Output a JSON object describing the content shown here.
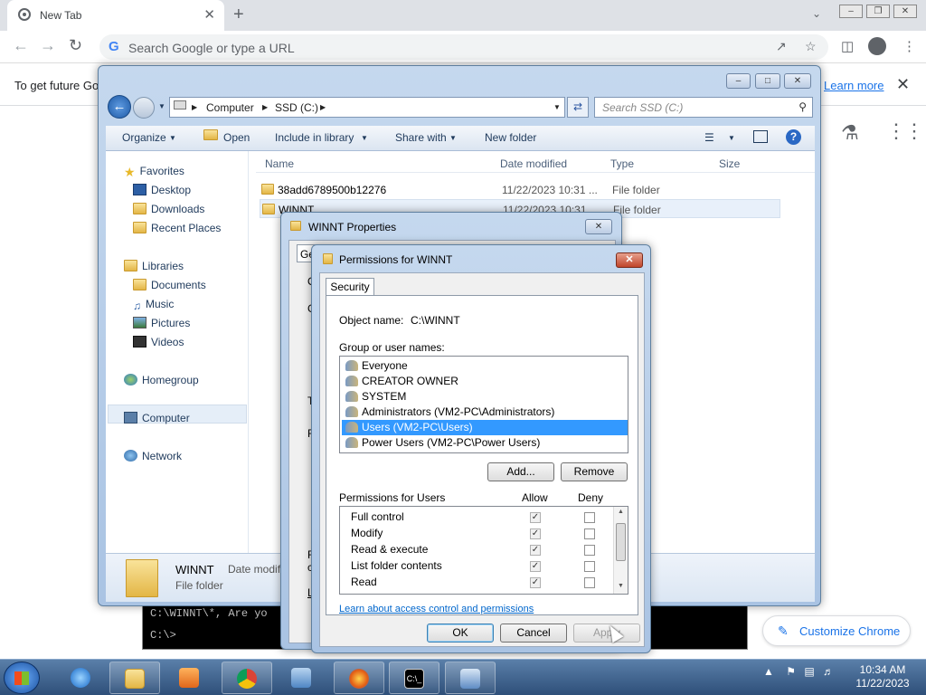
{
  "chrome": {
    "tab_title": "New Tab",
    "tab_close": "✕",
    "new_tab": "+",
    "omnibox_placeholder": "Search Google or type a URL",
    "infobar_message": "To get future Go",
    "infobar_learn_more": "Learn more",
    "customize_label": "Customize Chrome"
  },
  "explorer": {
    "breadcrumb": [
      "Computer",
      "SSD (C:)"
    ],
    "search_placeholder": "Search SSD (C:)",
    "commands": [
      "Organize",
      "Open",
      "Include in library",
      "Share with",
      "New folder"
    ],
    "nav": {
      "favorites": "Favorites",
      "favorites_items": [
        "Desktop",
        "Downloads",
        "Recent Places"
      ],
      "libraries": "Libraries",
      "libraries_items": [
        "Documents",
        "Music",
        "Pictures",
        "Videos"
      ],
      "homegroup": "Homegroup",
      "computer": "Computer",
      "network": "Network"
    },
    "columns": [
      "Name",
      "Date modified",
      "Type",
      "Size"
    ],
    "files": [
      {
        "name": "38add6789500b12276",
        "date": "11/22/2023 10:31 ...",
        "type": "File folder"
      },
      {
        "name": "WINNT",
        "date": "11/22/2023 10:31",
        "type": "File folder"
      }
    ],
    "details": {
      "name": "WINNT",
      "meta_label": "Date modif",
      "type": "File folder"
    }
  },
  "properties": {
    "title": "WINNT Properties",
    "partial_tab": "Ge",
    "partial_letters": [
      "O",
      "G",
      "T",
      "F",
      "F",
      "c",
      "L"
    ]
  },
  "permissions": {
    "title": "Permissions for WINNT",
    "tab": "Security",
    "object_label": "Object name:",
    "object_value": "C:\\WINNT",
    "group_label": "Group or user names:",
    "users": [
      {
        "name": "Everyone",
        "selected": false
      },
      {
        "name": "CREATOR OWNER",
        "selected": false
      },
      {
        "name": "SYSTEM",
        "selected": false
      },
      {
        "name": "Administrators (VM2-PC\\Administrators)",
        "selected": false
      },
      {
        "name": "Users (VM2-PC\\Users)",
        "selected": true
      },
      {
        "name": "Power Users (VM2-PC\\Power Users)",
        "selected": false
      }
    ],
    "add_button": "Add...",
    "remove_button": "Remove",
    "perms_for_label": "Permissions for Users",
    "allow_header": "Allow",
    "deny_header": "Deny",
    "perms": [
      {
        "name": "Full control",
        "allow": true,
        "deny": false
      },
      {
        "name": "Modify",
        "allow": true,
        "deny": false
      },
      {
        "name": "Read & execute",
        "allow": true,
        "deny": false
      },
      {
        "name": "List folder contents",
        "allow": true,
        "deny": false
      },
      {
        "name": "Read",
        "allow": true,
        "deny": false
      }
    ],
    "link": "Learn about access control and permissions",
    "ok": "OK",
    "cancel": "Cancel",
    "apply": "Apply"
  },
  "cmd": {
    "line1": "C:\\WINNT\\*, Are yo",
    "line2": "C:\\>"
  },
  "taskbar": {
    "time": "10:34 AM",
    "date": "11/22/2023"
  }
}
